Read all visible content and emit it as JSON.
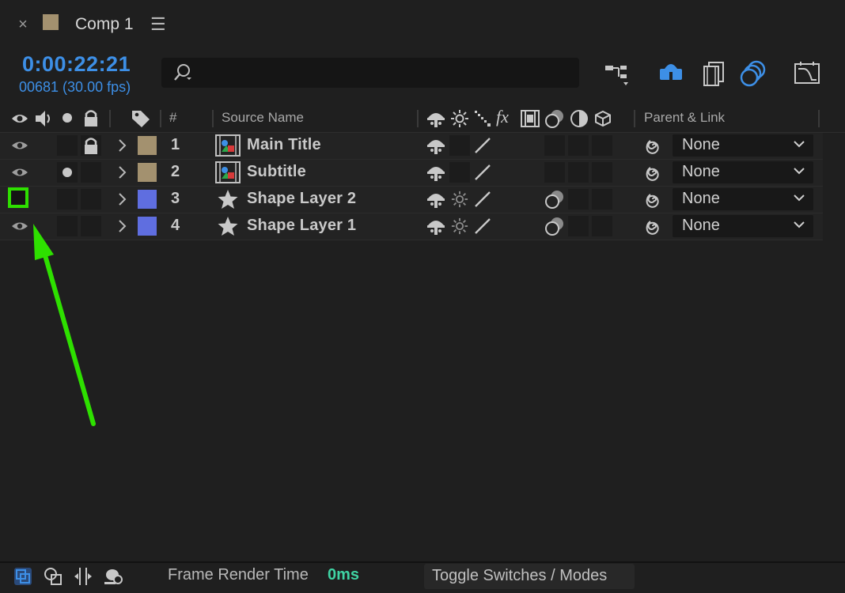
{
  "tab": {
    "close_glyph": "×",
    "title": "Comp 1",
    "menu_glyph": "☰",
    "swatch_color": "#a3916f"
  },
  "timeline": {
    "timecode": "0:00:22:21",
    "frame_fps": "00681 (30.00 fps)",
    "search_placeholder": ""
  },
  "top_icons": [
    "flowchart-icon",
    "draft-3d-icon",
    "frame-blending-icon",
    "motion-blur-icon",
    "graph-editor-icon"
  ],
  "columns": {
    "number": "#",
    "source_name": "Source Name",
    "parent_link": "Parent & Link",
    "fx": "fx"
  },
  "layers": [
    {
      "num": "1",
      "name": "Main Title",
      "type": "footage",
      "label_color": "#a3916f",
      "visible": true,
      "solo": false,
      "locked": true,
      "shape": false,
      "parent": "None"
    },
    {
      "num": "2",
      "name": "Subtitle",
      "type": "footage",
      "label_color": "#a3916f",
      "visible": true,
      "solo": true,
      "locked": false,
      "shape": false,
      "parent": "None"
    },
    {
      "num": "3",
      "name": "Shape Layer 2",
      "type": "shape",
      "label_color": "#5f6ee0",
      "visible": false,
      "solo": false,
      "locked": false,
      "shape": true,
      "parent": "None"
    },
    {
      "num": "4",
      "name": "Shape Layer 1",
      "type": "shape",
      "label_color": "#5f6ee0",
      "visible": true,
      "solo": false,
      "locked": false,
      "shape": true,
      "parent": "None"
    }
  ],
  "bottom": {
    "frame_render_label": "Frame Render Time",
    "frame_render_value": "0ms",
    "toggle_label": "Toggle Switches / Modes"
  },
  "annotation": {
    "highlight_color": "#2ee000",
    "arrow_color": "#2ee000"
  }
}
